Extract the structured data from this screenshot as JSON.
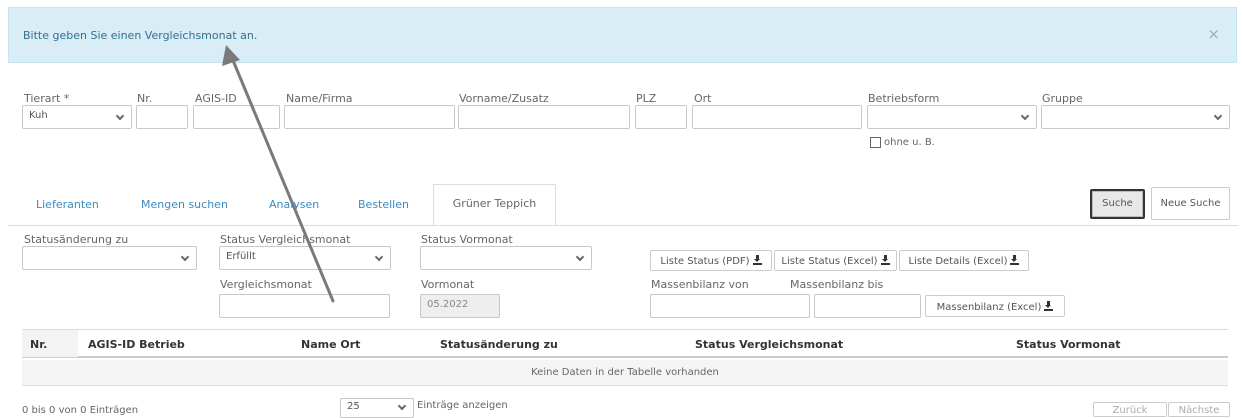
{
  "alert": {
    "message": "Bitte geben Sie einen Vergleichsmonat an.",
    "close": "×"
  },
  "search": {
    "tierart": {
      "label": "Tierart *",
      "value": "Kuh"
    },
    "nr": {
      "label": "Nr.",
      "value": ""
    },
    "agis_id": {
      "label": "AGIS-ID",
      "value": ""
    },
    "name_firma": {
      "label": "Name/Firma",
      "value": ""
    },
    "vorname_zusatz": {
      "label": "Vorname/Zusatz",
      "value": ""
    },
    "plz": {
      "label": "PLZ",
      "value": ""
    },
    "ort": {
      "label": "Ort",
      "value": ""
    },
    "betriebsform": {
      "label": "Betriebsform",
      "value": ""
    },
    "gruppe": {
      "label": "Gruppe",
      "value": ""
    },
    "ohne_label": "ohne u. B."
  },
  "tabs": [
    {
      "label": "Lieferanten"
    },
    {
      "label": "Mengen suchen"
    },
    {
      "label": "Analysen"
    },
    {
      "label": "Bestellen"
    },
    {
      "label": "Grüner Teppich"
    }
  ],
  "buttons": {
    "suche": "Suche",
    "neue_suche": "Neue Suche"
  },
  "filters": {
    "statusaenderung": {
      "label": "Statusänderung zu",
      "value": ""
    },
    "status_vergleichsmonat": {
      "label": "Status Vergleichsmonat",
      "value": "Erfüllt"
    },
    "status_vormonat": {
      "label": "Status Vormonat",
      "value": ""
    },
    "vergleichsmonat": {
      "label": "Vergleichsmonat",
      "value": ""
    },
    "vormonat": {
      "label": "Vormonat",
      "value": "05.2022"
    },
    "massenbilanz_von": {
      "label": "Massenbilanz von",
      "value": ""
    },
    "massenbilanz_bis": {
      "label": "Massenbilanz bis",
      "value": ""
    }
  },
  "export": {
    "liste_status_pdf": "Liste Status (PDF)",
    "liste_status_excel": "Liste Status (Excel)",
    "liste_details_excel": "Liste Details (Excel)",
    "massenbilanz_excel": "Massenbilanz (Excel)"
  },
  "table": {
    "columns": [
      "Nr.",
      "AGIS-ID Betrieb",
      "Name Ort",
      "Statusänderung zu",
      "Status Vergleichsmonat",
      "Status Vormonat"
    ],
    "empty_message": "Keine Daten in der Tabelle vorhanden"
  },
  "footer": {
    "info": "0 bis 0 von 0 Einträgen",
    "page_length": "25",
    "page_length_suffix": "Einträge anzeigen",
    "prev": "Zurück",
    "next": "Nächste"
  },
  "colors": {
    "alert_bg": "#d9edf7",
    "tab_link": "#3a8cc3",
    "arrow": "#7a7a7a"
  }
}
